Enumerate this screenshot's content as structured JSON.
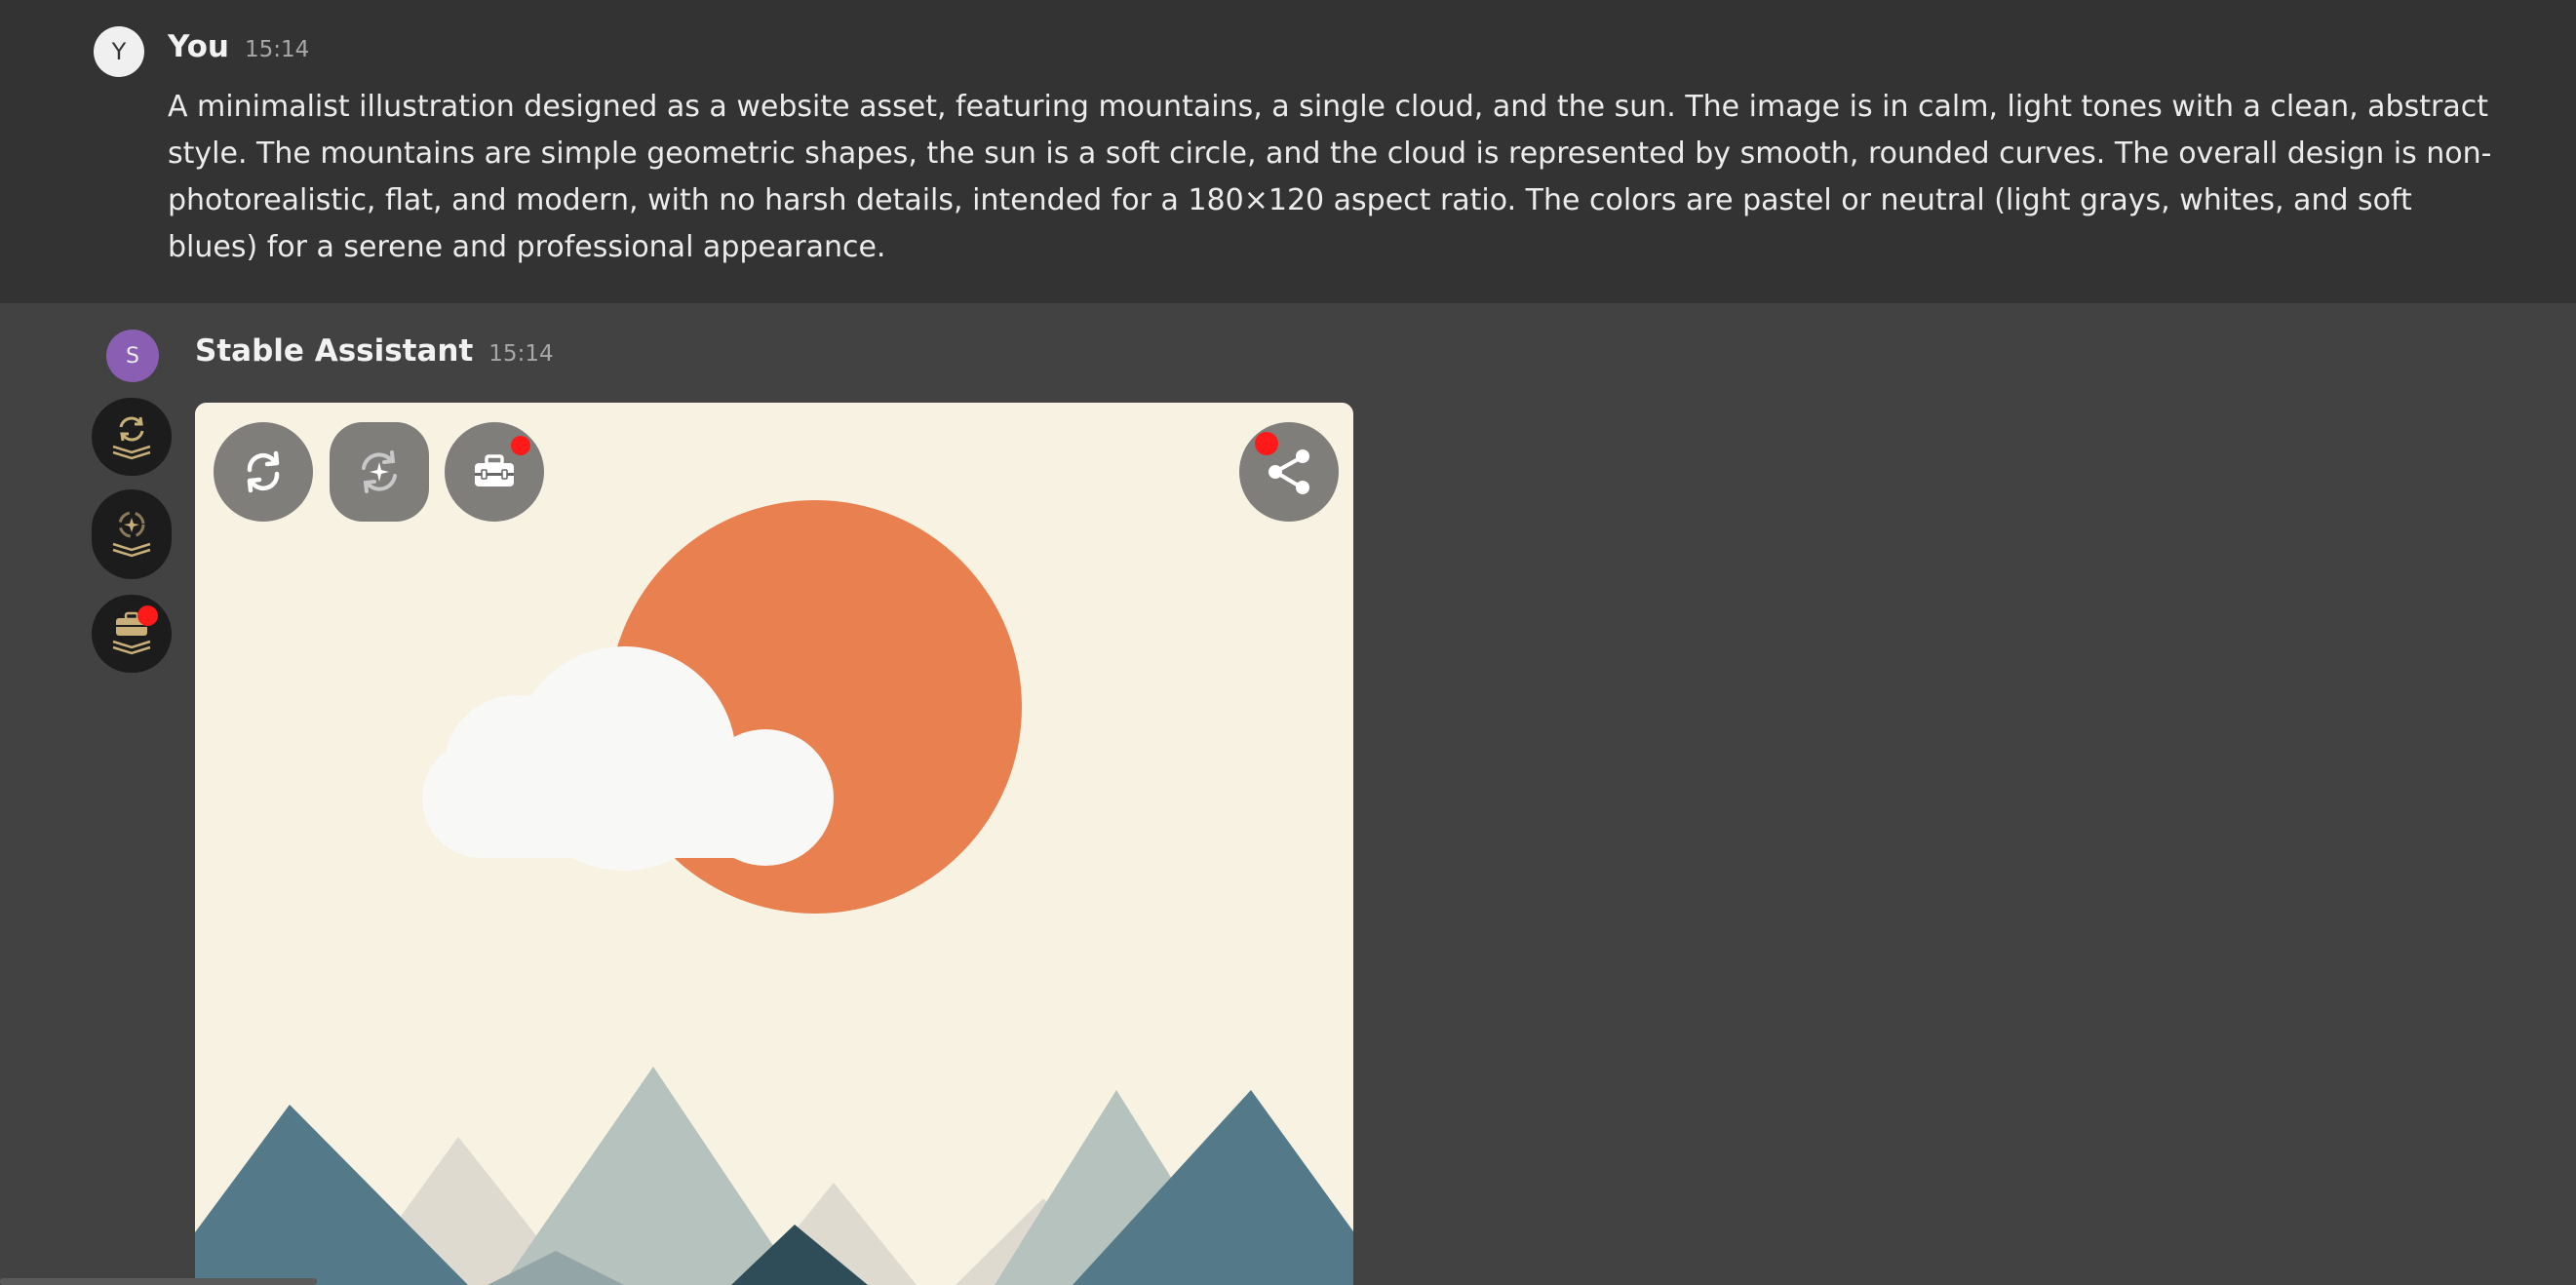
{
  "conversation": {
    "user_message": {
      "avatar_initial": "Y",
      "author": "You",
      "time": "15:14",
      "text": "A minimalist illustration designed as a website asset, featuring mountains, a single cloud, and the sun. The image is in calm, light tones with a clean, abstract style. The mountains are simple geometric shapes, the sun is a soft circle, and the cloud is represented by smooth, rounded curves. The overall design is non-photorealistic, flat, and modern, with no harsh details, intended for a 180×120 aspect ratio. The colors are pastel or neutral (light grays, whites, and soft blues) for a serene and professional appearance."
    },
    "assistant_message": {
      "avatar_initial": "S",
      "author": "Stable Assistant",
      "time": "15:14"
    }
  },
  "side_tools": [
    {
      "icon": "regenerate-stack-icon",
      "has_notification": false
    },
    {
      "icon": "enhance-stack-icon",
      "has_notification": false
    },
    {
      "icon": "toolbox-stack-icon",
      "has_notification": true
    }
  ],
  "image_actions": [
    {
      "icon": "regenerate-icon",
      "has_notification": false
    },
    {
      "icon": "sparkle-regenerate-icon",
      "has_notification": false
    },
    {
      "icon": "toolbox-icon",
      "has_notification": true
    },
    {
      "icon": "share-icon",
      "has_notification": true
    }
  ],
  "colors": {
    "user_bg": "#333333",
    "assistant_bg": "#424242",
    "assistant_avatar": "#8a5fb3",
    "notification": "#ff1a1a",
    "sun": "#e8804f",
    "canvas": "#f7f2e2"
  }
}
